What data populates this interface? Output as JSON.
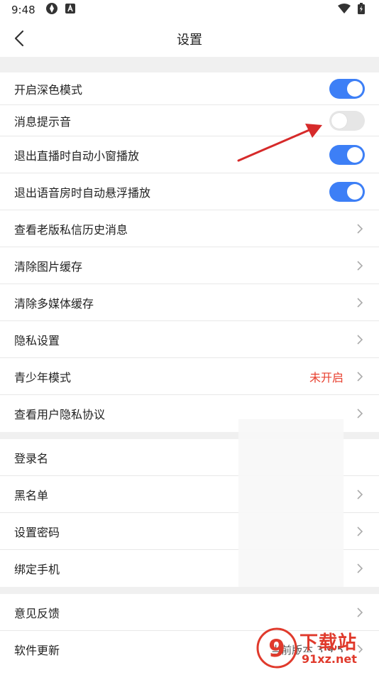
{
  "status": {
    "time": "9:48"
  },
  "nav": {
    "title": "设置"
  },
  "section1": [
    {
      "label": "开启深色模式",
      "control": "toggle",
      "on": true
    },
    {
      "label": "消息提示音",
      "control": "toggle",
      "on": false
    },
    {
      "label": "退出直播时自动小窗播放",
      "control": "toggle",
      "on": true
    },
    {
      "label": "退出语音房时自动悬浮播放",
      "control": "toggle",
      "on": true
    },
    {
      "label": "查看老版私信历史消息",
      "control": "chevron"
    },
    {
      "label": "清除图片缓存",
      "control": "chevron"
    },
    {
      "label": "清除多媒体缓存",
      "control": "chevron"
    },
    {
      "label": "隐私设置",
      "control": "chevron"
    },
    {
      "label": "青少年模式",
      "control": "chevron",
      "value": "未开启"
    },
    {
      "label": "查看用户隐私协议",
      "control": "chevron"
    }
  ],
  "section2": [
    {
      "label": "登录名"
    },
    {
      "label": "黑名单"
    },
    {
      "label": "设置密码"
    },
    {
      "label": "绑定手机"
    }
  ],
  "section3": [
    {
      "label": "意见反馈"
    },
    {
      "label": "软件更新",
      "value": "当前版本 3.9.5"
    }
  ],
  "watermark": {
    "brand": "下载站",
    "url": "91xz.net",
    "logo": "9"
  },
  "colors": {
    "toggle_on": "#3d7ff6",
    "toggle_off": "#e6e6e6",
    "accent_red": "#e8402f",
    "section_gap": "#f0f0f0"
  }
}
